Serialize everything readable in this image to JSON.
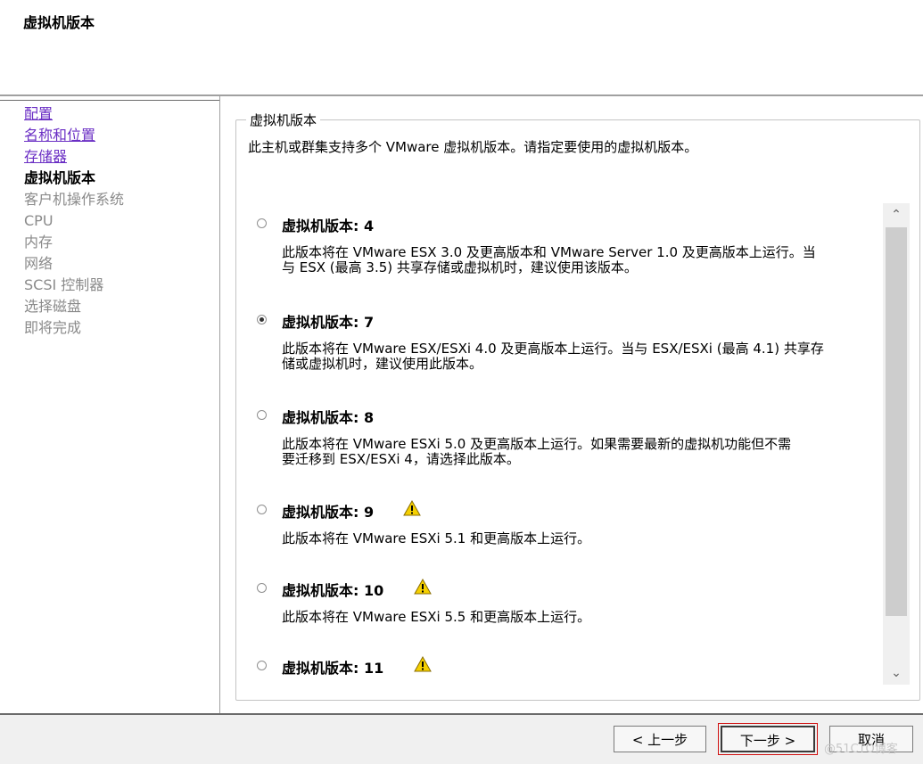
{
  "header": {
    "title": "虚拟机版本"
  },
  "nav": {
    "items": [
      {
        "label": "配置",
        "state": "link"
      },
      {
        "label": "名称和位置",
        "state": "link"
      },
      {
        "label": "存储器",
        "state": "link"
      },
      {
        "label": "虚拟机版本",
        "state": "current"
      },
      {
        "label": "客户机操作系统",
        "state": "disabled"
      },
      {
        "label": "CPU",
        "state": "disabled"
      },
      {
        "label": "内存",
        "state": "disabled"
      },
      {
        "label": "网络",
        "state": "disabled"
      },
      {
        "label": "SCSI 控制器",
        "state": "disabled"
      },
      {
        "label": "选择磁盘",
        "state": "disabled"
      },
      {
        "label": "即将完成",
        "state": "disabled"
      }
    ]
  },
  "main": {
    "group_title": "虚拟机版本",
    "description": "此主机或群集支持多个 VMware 虚拟机版本。请指定要使用的虚拟机版本。",
    "versions": [
      {
        "title": "虚拟机版本: 4",
        "selected": false,
        "warning": false,
        "desc_line1": "此版本将在 VMware ESX 3.0 及更高版本和 VMware Server 1.0 及更高版本上运行。当",
        "desc_line2": "与 ESX (最高 3.5) 共享存储或虚拟机时，建议使用该版本。"
      },
      {
        "title": "虚拟机版本: 7",
        "selected": true,
        "warning": false,
        "desc_line1": "此版本将在 VMware ESX/ESXi 4.0 及更高版本上运行。当与 ESX/ESXi (最高 4.1) 共享存",
        "desc_line2": "储或虚拟机时，建议使用此版本。"
      },
      {
        "title": "虚拟机版本: 8",
        "selected": false,
        "warning": false,
        "desc_line1": "此版本将在 VMware ESXi 5.0 及更高版本上运行。如果需要最新的虚拟机功能但不需",
        "desc_line2": "要迁移到 ESX/ESXi 4，请选择此版本。"
      },
      {
        "title": "虚拟机版本: 9",
        "selected": false,
        "warning": true,
        "desc_line1": "此版本将在 VMware ESXi 5.1 和更高版本上运行。",
        "desc_line2": ""
      },
      {
        "title": "虚拟机版本: 10",
        "selected": false,
        "warning": true,
        "desc_line1": "此版本将在 VMware ESXi 5.5 和更高版本上运行。",
        "desc_line2": ""
      },
      {
        "title": "虚拟机版本: 11",
        "selected": false,
        "warning": true,
        "desc_line1": "",
        "desc_line2": ""
      }
    ]
  },
  "footer": {
    "back_label": "< 上一步",
    "next_label": "下一步 >",
    "cancel_label": "取消",
    "watermark": "@51CTO博客"
  },
  "icons": {
    "warning": "warning-triangle-icon",
    "scroll_up": "chevron-up-icon",
    "scroll_down": "chevron-down-icon"
  },
  "colors": {
    "link": "#6a2ec4",
    "disabled": "#8a8a8a",
    "warning_fill": "#f5d000",
    "highlight_box": "#d01010"
  }
}
